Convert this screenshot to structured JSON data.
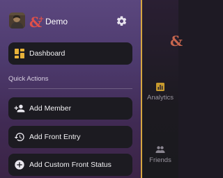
{
  "app": {
    "name": "Demo"
  },
  "drawer": {
    "dashboard_label": "Dashboard",
    "section_title": "Quick Actions",
    "actions": [
      {
        "label": "Add Member",
        "icon": "person-add-icon"
      },
      {
        "label": "Add Front Entry",
        "icon": "history-icon"
      },
      {
        "label": "Add Custom Front Status",
        "icon": "add-circle-icon"
      }
    ]
  },
  "background_nav": {
    "analytics_label": "Analytics",
    "friends_label": "Friends"
  },
  "colors": {
    "drawer_top": "#5b477e",
    "drawer_bottom": "#3b2446",
    "button_bg": "#1c1b21",
    "dashboard_icon": "#e8b23a",
    "logo_red": "#e0504a",
    "edge_accent": "#d7a640"
  }
}
